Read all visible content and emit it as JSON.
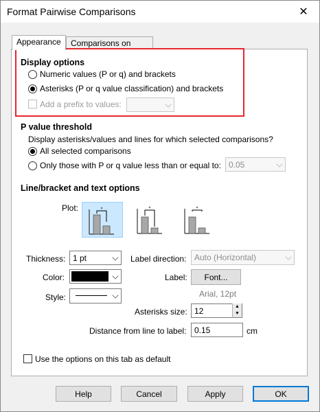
{
  "window": {
    "title": "Format Pairwise Comparisons",
    "close": "✕"
  },
  "tabs": [
    {
      "label": "Appearance",
      "active": true
    },
    {
      "label": "Comparisons on Graph",
      "active": false
    }
  ],
  "display_options": {
    "heading": "Display options",
    "numeric_label": "Numeric values (P or q) and brackets",
    "asterisks_label": "Asterisks (P or q value classification) and brackets",
    "selected": "asterisks",
    "prefix_label": "Add a prefix to values:",
    "prefix_value": ""
  },
  "p_threshold": {
    "heading": "P value threshold",
    "description": "Display asterisks/values and lines for which selected comparisons?",
    "all_label": "All selected comparisons",
    "only_label": "Only those with P or q value less than or equal to:",
    "threshold_value": "0.05",
    "selected": "all"
  },
  "line_options": {
    "heading": "Line/bracket and text options",
    "plot_label": "Plot:",
    "thickness_label": "Thickness:",
    "thickness_value": "1 pt",
    "color_label": "Color:",
    "style_label": "Style:",
    "label_direction_label": "Label direction:",
    "label_direction_value": "Auto (Horizontal)",
    "label_label": "Label:",
    "font_button": "Font...",
    "font_desc": "Arial, 12pt",
    "asterisks_size_label": "Asterisks size:",
    "asterisks_size_value": "12",
    "distance_label": "Distance from line to label:",
    "distance_value": "0.15",
    "distance_unit": "cm",
    "line_color": "#000000"
  },
  "default_option": {
    "label": "Use the options on this tab as default",
    "checked": false
  },
  "buttons": {
    "help": "Help",
    "cancel": "Cancel",
    "apply": "Apply",
    "ok": "OK"
  },
  "colors": {
    "highlight": "#e5262d",
    "selected_plot": "#cce8ff",
    "accent": "#0078d7"
  }
}
